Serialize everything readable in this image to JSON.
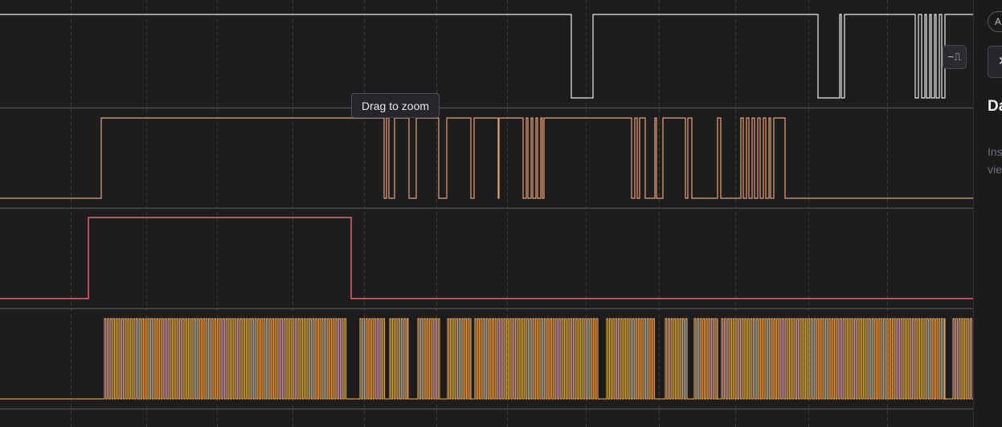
{
  "tooltip": {
    "text": "Drag to zoom"
  },
  "toolbar": {
    "waveform_toggle_glyph": "~⎍"
  },
  "sidebar": {
    "pill_text": "A",
    "close_glyph": "✕",
    "title": "Da",
    "hint_line1": "Ins",
    "hint_line2": "vie"
  },
  "colors": {
    "background": "#1d1d1f",
    "grid": "#3a3a3d",
    "separator": "#4b4b4f",
    "channel_1": "#e8e8e8",
    "channel_2": "#e9a074",
    "channel_3": "#f0656b",
    "channel_4": "#f3b060"
  }
}
